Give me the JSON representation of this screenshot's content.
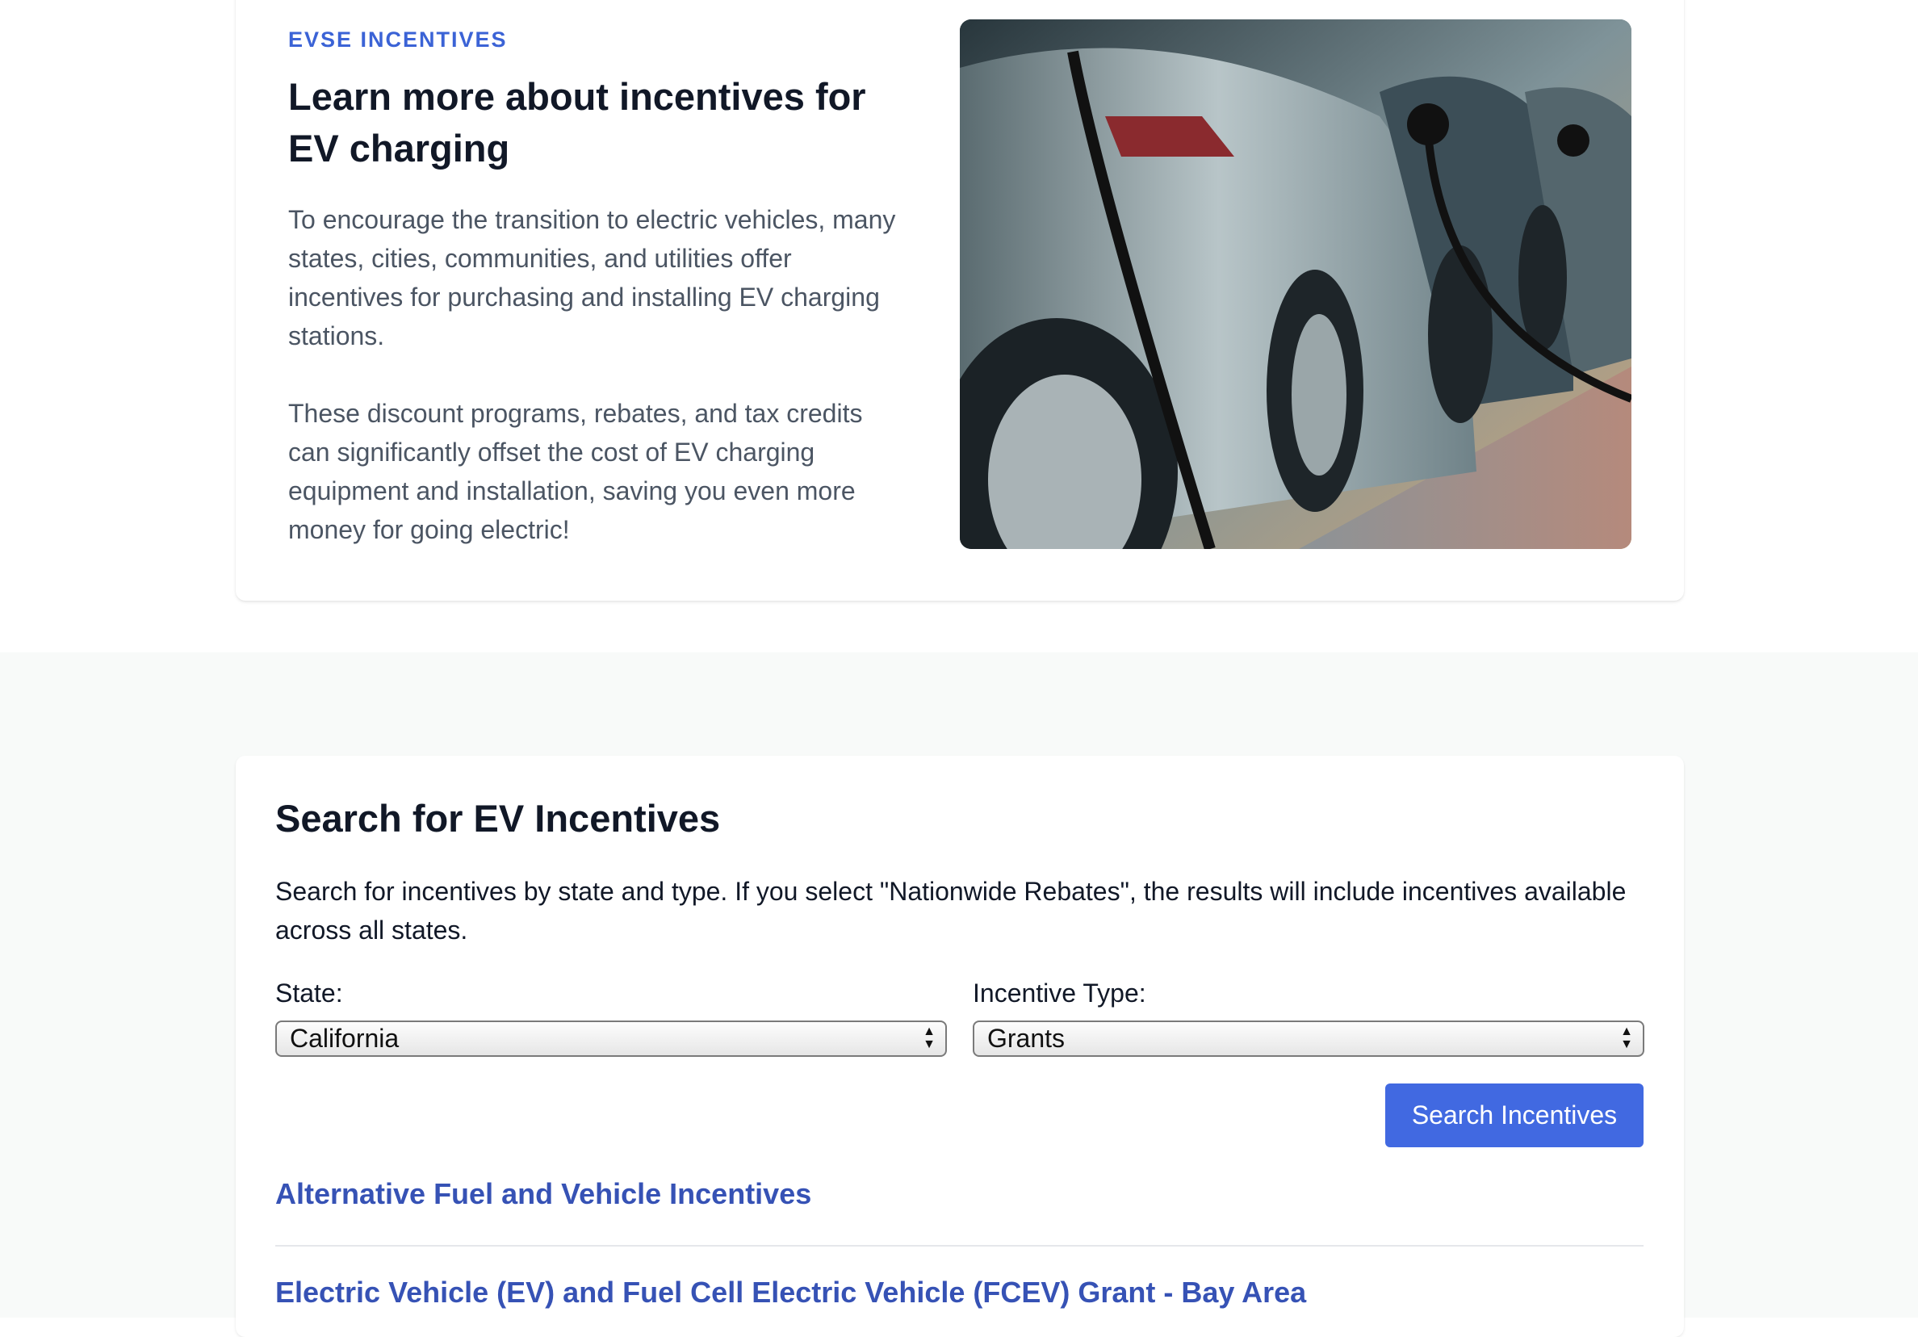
{
  "hero": {
    "eyebrow": "EVSE INCENTIVES",
    "title": "Learn more about incentives for EV charging",
    "paragraph1": "To encourage the transition to electric vehicles, many states, cities, communities, and utilities offer incentives for purchasing and installing EV charging stations.",
    "paragraph2": "These discount programs, rebates, and tax credits can significantly offset the cost of EV charging equipment and installation, saving you even more money for going electric!"
  },
  "search": {
    "title": "Search for EV Incentives",
    "description": "Search for incentives by state and type. If you select \"Nationwide Rebates\", the results will include incentives available across all states.",
    "state_label": "State:",
    "state_value": "California",
    "type_label": "Incentive Type:",
    "type_value": "Grants",
    "button_label": "Search Incentives"
  },
  "results": [
    {
      "title": "Alternative Fuel and Vehicle Incentives"
    },
    {
      "title": "Electric Vehicle (EV) and Fuel Cell Electric Vehicle (FCEV) Grant - Bay Area"
    }
  ],
  "colors": {
    "accent": "#4169e1",
    "eyebrow": "#3b63d6",
    "link": "#3652b5"
  }
}
